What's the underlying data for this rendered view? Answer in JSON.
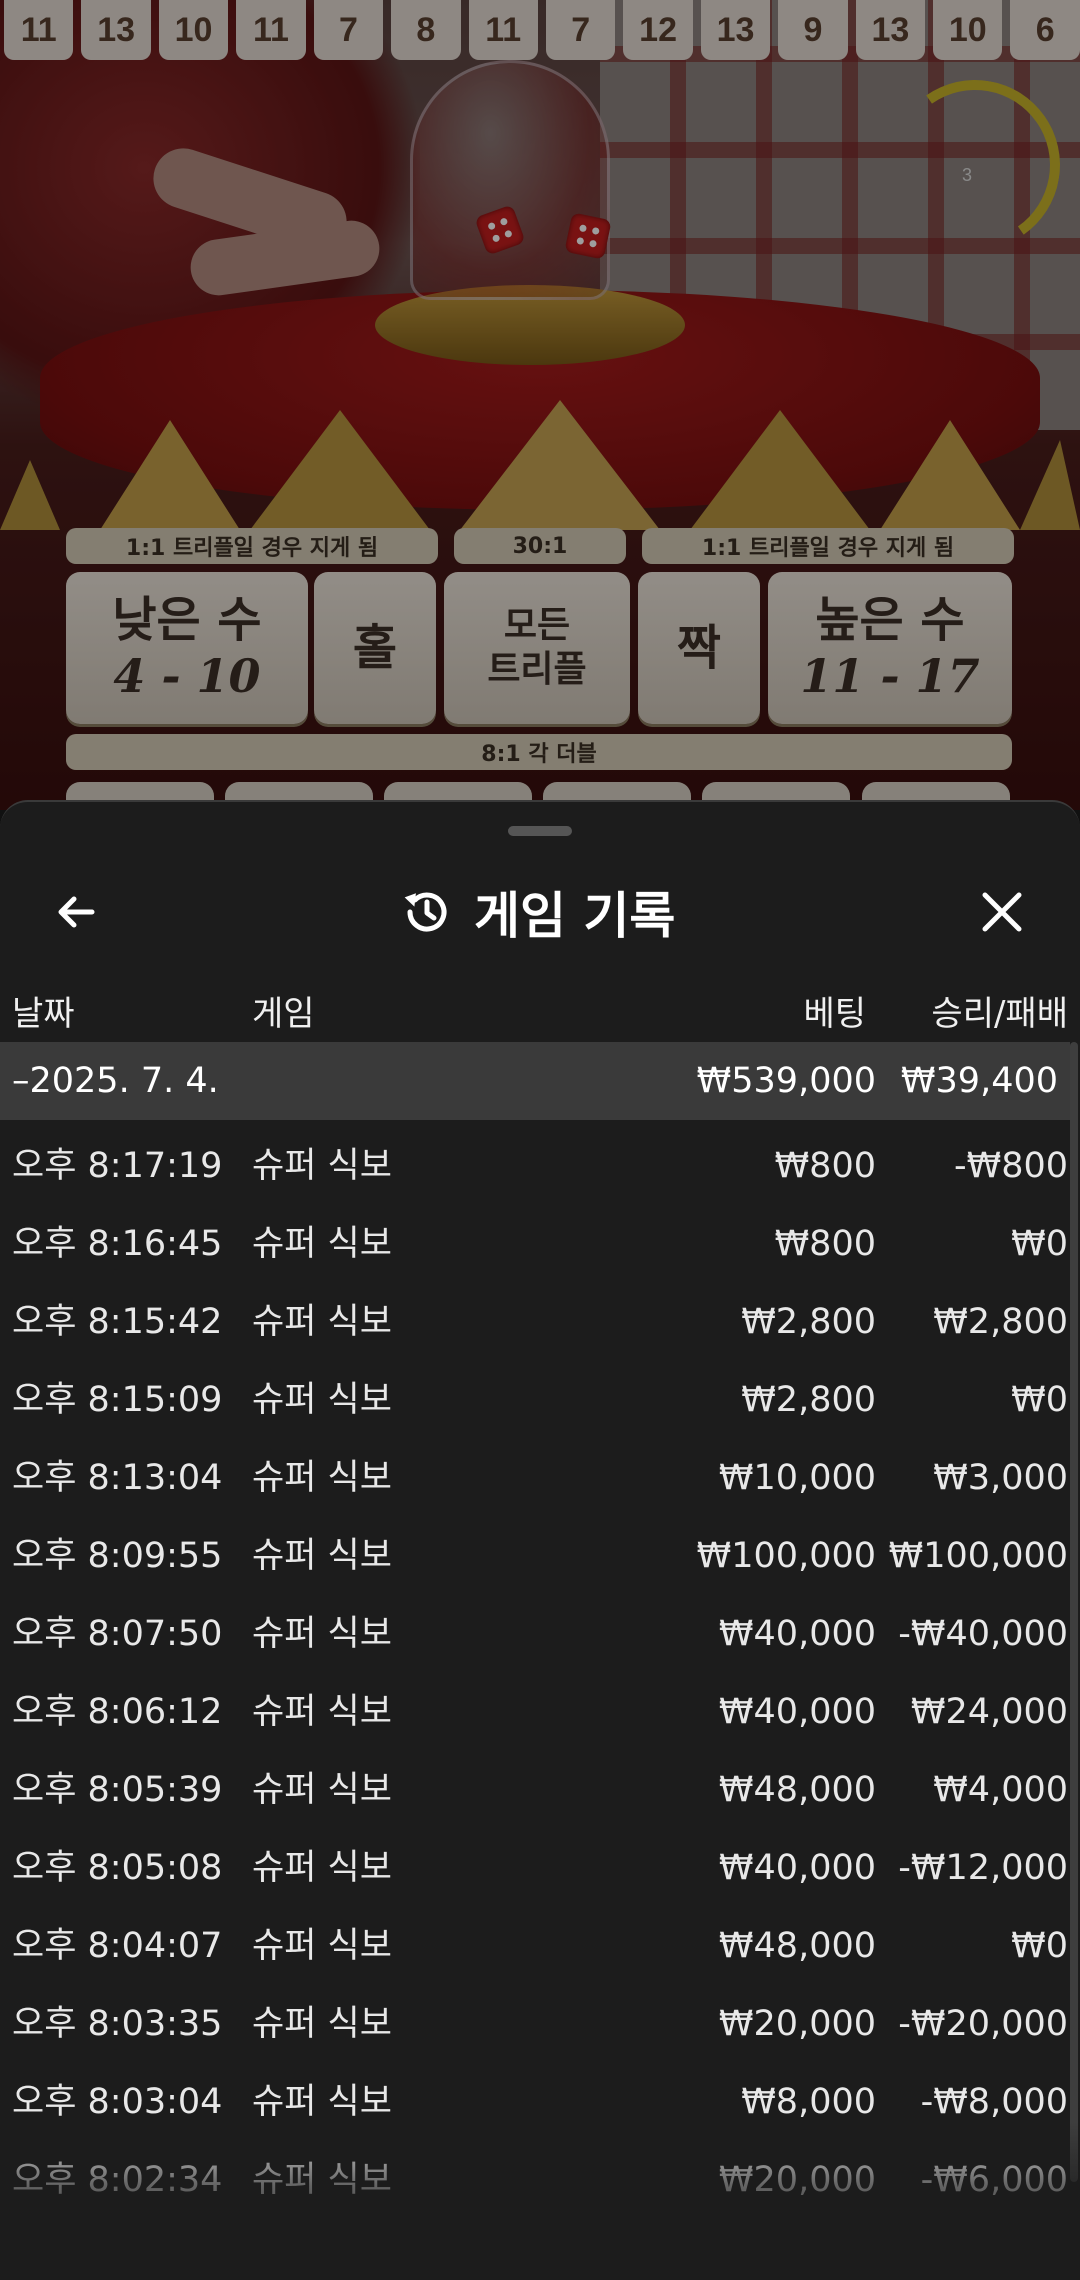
{
  "roadmap": [
    "11",
    "13",
    "10",
    "11",
    "7",
    "8",
    "11",
    "7",
    "12",
    "13",
    "9",
    "13",
    "10",
    "6"
  ],
  "timer": {
    "value": "3"
  },
  "board": {
    "odds_left": "1:1 트리플일 경우 지게 됨",
    "odds_center": "30:1",
    "odds_right": "1:1 트리플일 경우 지게 됨",
    "low_label": "낮은 수",
    "low_range": "4 - 10",
    "odd_label": "홀",
    "any_triple_line1": "모든",
    "any_triple_line2": "트리플",
    "even_label": "짝",
    "high_label": "높은 수",
    "high_range": "11 - 17",
    "double_odds": "8:1 각 더블"
  },
  "history": {
    "title": "게임 기록",
    "columns": {
      "date": "날짜",
      "game": "게임",
      "bet": "베팅",
      "result": "승리/패배"
    },
    "date_group": {
      "date": "–2025. 7. 4.",
      "bet_total": "₩539,000",
      "result_total": "₩39,400"
    },
    "rows": [
      {
        "time": "오후 8:17:19",
        "game": "슈퍼 식보",
        "bet": "₩800",
        "result": "-₩800"
      },
      {
        "time": "오후 8:16:45",
        "game": "슈퍼 식보",
        "bet": "₩800",
        "result": "₩0"
      },
      {
        "time": "오후 8:15:42",
        "game": "슈퍼 식보",
        "bet": "₩2,800",
        "result": "₩2,800"
      },
      {
        "time": "오후 8:15:09",
        "game": "슈퍼 식보",
        "bet": "₩2,800",
        "result": "₩0"
      },
      {
        "time": "오후 8:13:04",
        "game": "슈퍼 식보",
        "bet": "₩10,000",
        "result": "₩3,000"
      },
      {
        "time": "오후 8:09:55",
        "game": "슈퍼 식보",
        "bet": "₩100,000",
        "result": "₩100,000"
      },
      {
        "time": "오후 8:07:50",
        "game": "슈퍼 식보",
        "bet": "₩40,000",
        "result": "-₩40,000"
      },
      {
        "time": "오후 8:06:12",
        "game": "슈퍼 식보",
        "bet": "₩40,000",
        "result": "₩24,000"
      },
      {
        "time": "오후 8:05:39",
        "game": "슈퍼 식보",
        "bet": "₩48,000",
        "result": "₩4,000"
      },
      {
        "time": "오후 8:05:08",
        "game": "슈퍼 식보",
        "bet": "₩40,000",
        "result": "-₩12,000"
      },
      {
        "time": "오후 8:04:07",
        "game": "슈퍼 식보",
        "bet": "₩48,000",
        "result": "₩0"
      },
      {
        "time": "오후 8:03:35",
        "game": "슈퍼 식보",
        "bet": "₩20,000",
        "result": "-₩20,000"
      },
      {
        "time": "오후 8:03:04",
        "game": "슈퍼 식보",
        "bet": "₩8,000",
        "result": "-₩8,000"
      },
      {
        "time": "오후 8:02:34",
        "game": "슈퍼 식보",
        "bet": "₩20,000",
        "result": "-₩6,000"
      }
    ]
  },
  "icons": {
    "back": "arrow-left-icon",
    "history": "history-clock-icon",
    "close": "close-icon"
  },
  "colors": {
    "sheet_bg": "#1c1c1c",
    "date_row_bg": "#3a3a3a",
    "board_tile": "#e5dcd3",
    "timer_arc": "#c8b32a"
  }
}
